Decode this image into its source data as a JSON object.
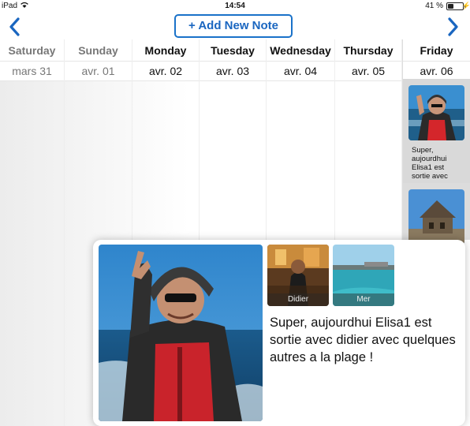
{
  "status_bar": {
    "device": "iPad",
    "time": "14:54",
    "battery_text": "41 %",
    "battery_level": 0.41
  },
  "header": {
    "add_button_label": "+ Add New Note"
  },
  "days": [
    {
      "name": "Saturday",
      "date": "mars 31"
    },
    {
      "name": "Sunday",
      "date": "avr. 01"
    },
    {
      "name": "Monday",
      "date": "avr. 02"
    },
    {
      "name": "Tuesday",
      "date": "avr. 03"
    },
    {
      "name": "Wednesday",
      "date": "avr. 04"
    },
    {
      "name": "Thursday",
      "date": "avr. 05"
    },
    {
      "name": "Friday",
      "date": "avr. 06"
    }
  ],
  "friday_note_preview": "Super, aujourdhui Elisa1 est sortie avec",
  "popup": {
    "thumbnails": [
      {
        "caption": "Didier"
      },
      {
        "caption": "Mer"
      }
    ],
    "note_text": "Super, aujourdhui Elisa1 est sortie avec didier avec quelques autres a la plage !"
  },
  "colors": {
    "accent": "#1a72c9",
    "card_bg": "#d9d9d9"
  }
}
